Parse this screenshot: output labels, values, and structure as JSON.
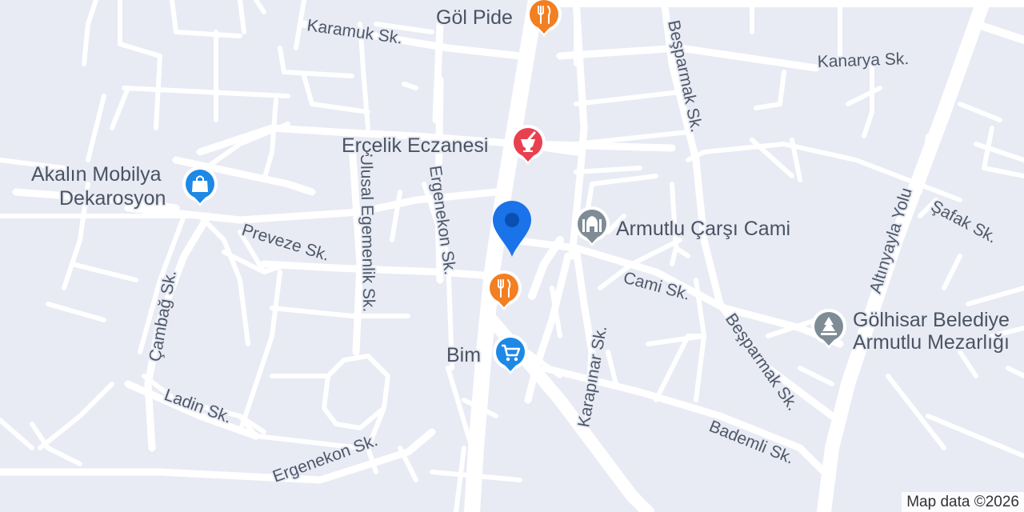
{
  "map": {
    "colors": {
      "background": "#e8ebf4",
      "road": "#ffffff",
      "restaurant": "#f27f22",
      "pharmacy": "#e9404f",
      "shopping": "#1e88e5",
      "mosque": "#7f8c95",
      "cemetery": "#7f8c95",
      "location_pin": "#1a73e8"
    },
    "streets": {
      "karamuk": "Karamuk Sk.",
      "kanarya": "Kanarya Sk.",
      "besparmak_north": "Beşparmak Sk.",
      "besparmak_south": "Beşparmak Sk.",
      "ulusal_egemenlik": "Ulusal Egemenlik Sk.",
      "ergenekon_north": "Ergenekon Sk.",
      "ergenekon_south": "Ergenekon Sk.",
      "preveze": "Preveze Sk.",
      "cambag": "Çambağ Sk.",
      "ladin": "Ladin Sk.",
      "cami": "Cami Sk.",
      "karapinar": "Karapınar Sk.",
      "bademli": "Bademli Sk.",
      "altinyayla": "Altınyayla Yolu",
      "safak": "Şafak Sk."
    },
    "pois": {
      "gol_pide": {
        "name": "Göl Pide",
        "icon": "restaurant-icon"
      },
      "ercelik": {
        "name": "Erçelik Eczanesi",
        "icon": "pharmacy-icon"
      },
      "akalin_line1": "Akalın Mobilya",
      "akalin_line2": "Dekarosyon",
      "akalin_icon": "shopping-bag-icon",
      "armutlu_cami": {
        "name": "Armutlu Çarşı Cami",
        "icon": "mosque-icon"
      },
      "restaurant2": {
        "icon": "restaurant-icon"
      },
      "bim": {
        "name": "Bim",
        "icon": "shopping-cart-icon"
      },
      "golhisar_line1": "Gölhisar Belediye",
      "golhisar_line2": "Armutlu Mezarlığı",
      "golhisar_icon": "cemetery-icon"
    },
    "attribution": "Map data ©2026"
  }
}
